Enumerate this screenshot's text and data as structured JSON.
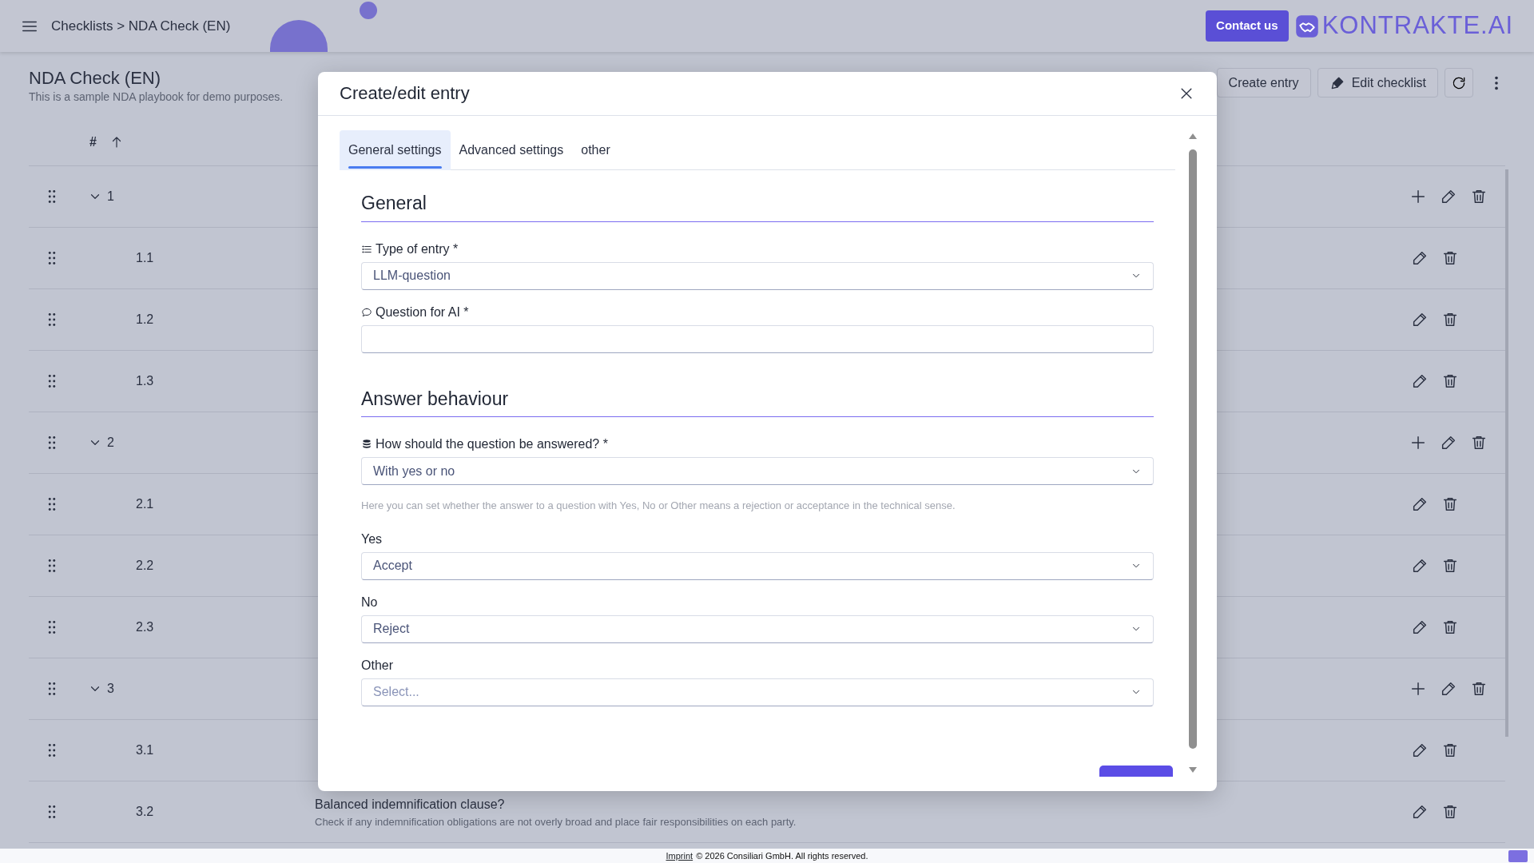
{
  "header": {
    "breadcrumb": "Checklists > NDA Check (EN)",
    "contact_button": "Contact us",
    "logo_text": "KONTRAKTE.AI"
  },
  "page": {
    "title": "NDA Check (EN)",
    "subtitle": "This is a sample NDA playbook for demo purposes.",
    "buttons": [
      "Create entry",
      "Edit checklist"
    ]
  },
  "table": {
    "columns": [
      {
        "label": "#",
        "sorted": true
      }
    ],
    "rows": [
      {
        "kind": "group",
        "number": "1",
        "expanded": true
      },
      {
        "kind": "item",
        "number": "1.1"
      },
      {
        "kind": "item",
        "number": "1.2"
      },
      {
        "kind": "item",
        "number": "1.3"
      },
      {
        "kind": "group",
        "number": "2",
        "expanded": true
      },
      {
        "kind": "item",
        "number": "2.1"
      },
      {
        "kind": "item",
        "number": "2.2"
      },
      {
        "kind": "item",
        "number": "2.3"
      },
      {
        "kind": "group",
        "number": "3",
        "expanded": true
      },
      {
        "kind": "item",
        "number": "3.1"
      },
      {
        "kind": "item",
        "number": "3.2",
        "title": "Balanced indemnification clause?",
        "description": "Check if any indemnification obligations are not overly broad and place fair responsibilities on each party."
      }
    ]
  },
  "modal": {
    "title": "Create/edit entry",
    "tabs": [
      {
        "label": "General settings",
        "selected": true
      },
      {
        "label": "Advanced settings",
        "selected": false
      },
      {
        "label": "other",
        "selected": false
      }
    ],
    "sections": [
      {
        "heading": "General",
        "fields": [
          {
            "kind": "select",
            "label": "Type of entry *",
            "label_icon": true,
            "value": "LLM-question"
          },
          {
            "kind": "text",
            "label": "Question for AI *",
            "label_icon": true
          }
        ]
      },
      {
        "heading": "Answer behaviour",
        "fields": [
          {
            "kind": "select",
            "label": "How should the question be answered? *",
            "label_icon": true,
            "value": "With yes or no"
          },
          {
            "kind": "note",
            "text": "Here you can set whether the answer to a question with Yes, No or Other means a rejection or acceptance in the technical sense."
          },
          {
            "kind": "select",
            "label": "Yes",
            "label_icon": false,
            "value": "Accept"
          },
          {
            "kind": "select",
            "label": "No",
            "label_icon": false,
            "value": "Reject"
          },
          {
            "kind": "select",
            "label": "Other",
            "label_icon": false,
            "placeholder": "Select..."
          }
        ]
      }
    ]
  },
  "footer": {
    "link": "Imprint",
    "text": "© 2026 Consiliari GmbH. All rights reserved."
  }
}
